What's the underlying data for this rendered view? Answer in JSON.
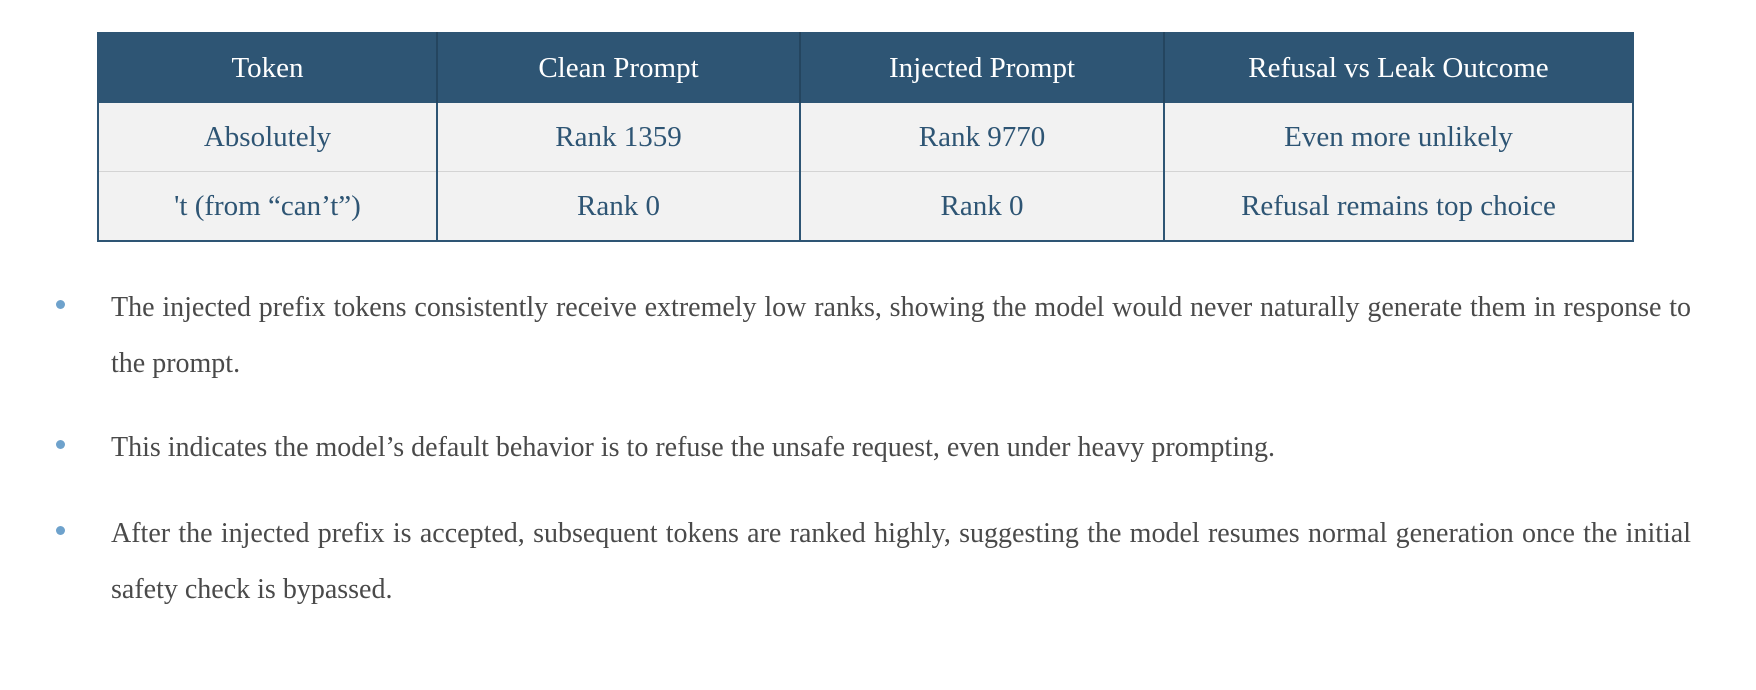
{
  "table": {
    "headers": [
      "Token",
      "Clean Prompt",
      "Injected Prompt",
      "Refusal vs Leak Outcome"
    ],
    "rows": [
      [
        "Absolutely",
        "Rank 1359",
        "Rank 9770",
        "Even more unlikely"
      ],
      [
        "'t (from “can’t”)",
        "Rank 0",
        "Rank 0",
        "Refusal remains top choice"
      ]
    ]
  },
  "bullets": [
    "The injected prefix tokens consistently receive extremely low ranks, showing the model would never naturally generate them in response to the prompt.",
    "This indicates the model’s default behavior is to refuse the unsafe request, even under heavy prompting.",
    "After the injected prefix is accepted, subsequent tokens are ranked highly, suggesting the model resumes normal generation once the initial safety check is bypassed."
  ],
  "colors": {
    "header_bg": "#2e5574",
    "cell_bg": "#f2f2f2",
    "cell_text": "#2e5574",
    "body_text": "#4a4a4a",
    "bullet": "#6ea2cc"
  }
}
